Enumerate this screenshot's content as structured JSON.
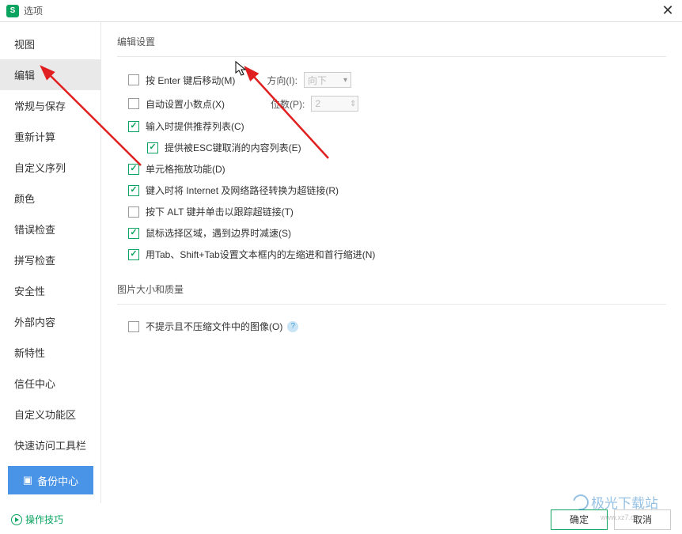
{
  "titlebar": {
    "logo_text": "S",
    "title": "选项"
  },
  "sidebar": {
    "items": [
      {
        "label": "视图"
      },
      {
        "label": "编辑"
      },
      {
        "label": "常规与保存"
      },
      {
        "label": "重新计算"
      },
      {
        "label": "自定义序列"
      },
      {
        "label": "颜色"
      },
      {
        "label": "错误检查"
      },
      {
        "label": "拼写检查"
      },
      {
        "label": "安全性"
      },
      {
        "label": "外部内容"
      },
      {
        "label": "新特性"
      },
      {
        "label": "信任中心"
      },
      {
        "label": "自定义功能区"
      },
      {
        "label": "快速访问工具栏"
      }
    ],
    "backup_label": "备份中心"
  },
  "content": {
    "section1_title": "编辑设置",
    "section2_title": "图片大小和质量",
    "rows": {
      "r1": "按 Enter 键后移动(M)",
      "r1_dir_label": "方向(I):",
      "r1_dir_value": "向下",
      "r2": "自动设置小数点(X)",
      "r2_places_label": "位数(P):",
      "r2_places_value": "2",
      "r3": "输入时提供推荐列表(C)",
      "r3a": "提供被ESC键取消的内容列表(E)",
      "r4": "单元格拖放功能(D)",
      "r5": "键入时将 Internet 及网络路径转换为超链接(R)",
      "r6": "按下 ALT 键并单击以跟踪超链接(T)",
      "r7": "鼠标选择区域，遇到边界时减速(S)",
      "r8": "用Tab、Shift+Tab设置文本框内的左缩进和首行缩进(N)",
      "img1": "不提示且不压缩文件中的图像(O)"
    }
  },
  "footer": {
    "tips_label": "操作技巧",
    "ok_label": "确定",
    "cancel_label": "取消"
  },
  "watermark": {
    "text": "极光下载站",
    "url": "www.xz7.com"
  }
}
